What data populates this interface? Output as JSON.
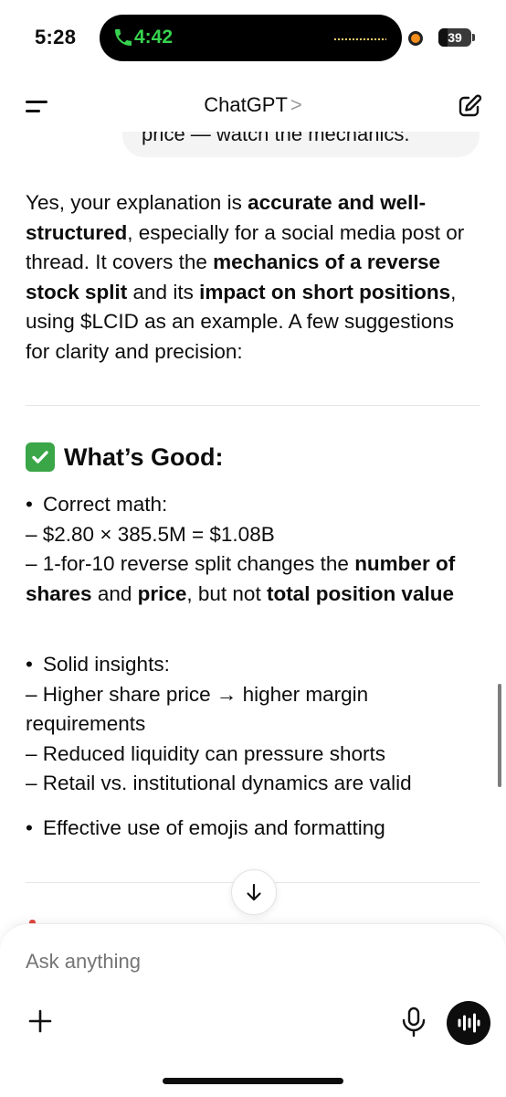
{
  "status_bar": {
    "time": "5:28",
    "call_time": "4:42",
    "battery": "39",
    "call_color": "#37d34f"
  },
  "header": {
    "title": "ChatGPT",
    "chevron": ">",
    "menu_icon": "menu-icon",
    "edit_icon": "new-chat-icon"
  },
  "user_bubble": {
    "partial_text": "price — watch the mechanics."
  },
  "response": {
    "intro": [
      {
        "t": "Yes, your explanation is "
      },
      {
        "t": "accurate and well-structured",
        "b": true
      },
      {
        "t": ", especially for a social media post or thread. It covers the "
      },
      {
        "t": "mechanics of a reverse stock split",
        "b": true
      },
      {
        "t": " and its "
      },
      {
        "t": "impact on short positions",
        "b": true
      },
      {
        "t": ", using $LCID as an example. A few suggestions for clarity and precision:"
      }
    ],
    "section_heading": "What’s Good:",
    "section_icon": "check-mark-emoji",
    "bullet_symbol": "•",
    "bullets": [
      {
        "title": "Correct math:",
        "lines": [
          [
            {
              "t": "– $2.80 × 385.5M = $1.08B"
            }
          ],
          [
            {
              "t": "– 1-for-10 reverse split changes the "
            },
            {
              "t": "number of shares",
              "b": true
            },
            {
              "t": " and "
            },
            {
              "t": "price",
              "b": true
            },
            {
              "t": ", but not "
            },
            {
              "t": "total position value",
              "b": true
            }
          ]
        ]
      },
      {
        "title": "Solid insights:",
        "lines": [
          [
            {
              "t": "– Higher share price → higher margin requirements"
            }
          ],
          [
            {
              "t": "– Reduced liquidity can pressure shorts"
            }
          ],
          [
            {
              "t": "– Retail vs. institutional dynamics are valid"
            }
          ]
        ]
      },
      {
        "title": "Effective use of emojis and formatting",
        "lines": []
      }
    ]
  },
  "composer": {
    "placeholder": "Ask anything",
    "plus_icon": "plus-icon",
    "mic_icon": "microphone-icon",
    "voice_icon": "voice-mode-icon"
  },
  "scroll_icon": "arrow-down-icon"
}
